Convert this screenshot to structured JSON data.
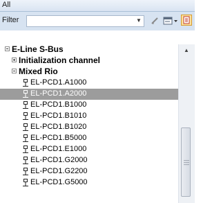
{
  "header": {
    "title": "All"
  },
  "filter": {
    "label": "Filter",
    "value": "",
    "dropdown_icon": "chevron-down-icon",
    "clear_icon": "clear-filter-icon",
    "options_icon": "options-icon",
    "highlight_icon": "highlight-icon"
  },
  "tree": {
    "root": {
      "label": "E-Line S-Bus",
      "state": "expanded"
    },
    "groups": [
      {
        "label": "Initialization channel",
        "state": "collapsed"
      },
      {
        "label": "Mixed Rio",
        "state": "expanded"
      }
    ],
    "items": [
      {
        "label": "EL-PCD1.A1000"
      },
      {
        "label": "EL-PCD1.A2000",
        "selected": true
      },
      {
        "label": "EL-PCD1.B1000"
      },
      {
        "label": "EL-PCD1.B1010"
      },
      {
        "label": "EL-PCD1.B1020"
      },
      {
        "label": "EL-PCD1.B5000"
      },
      {
        "label": "EL-PCD1.E1000"
      },
      {
        "label": "EL-PCD1.G2000"
      },
      {
        "label": "EL-PCD1.G2200"
      },
      {
        "label": "EL-PCD1.G5000"
      }
    ]
  },
  "colors": {
    "header_bg": "#dfe8f4",
    "filter_bar_bg": "#d7e3f1",
    "selection_bg": "#9c9c9c"
  }
}
